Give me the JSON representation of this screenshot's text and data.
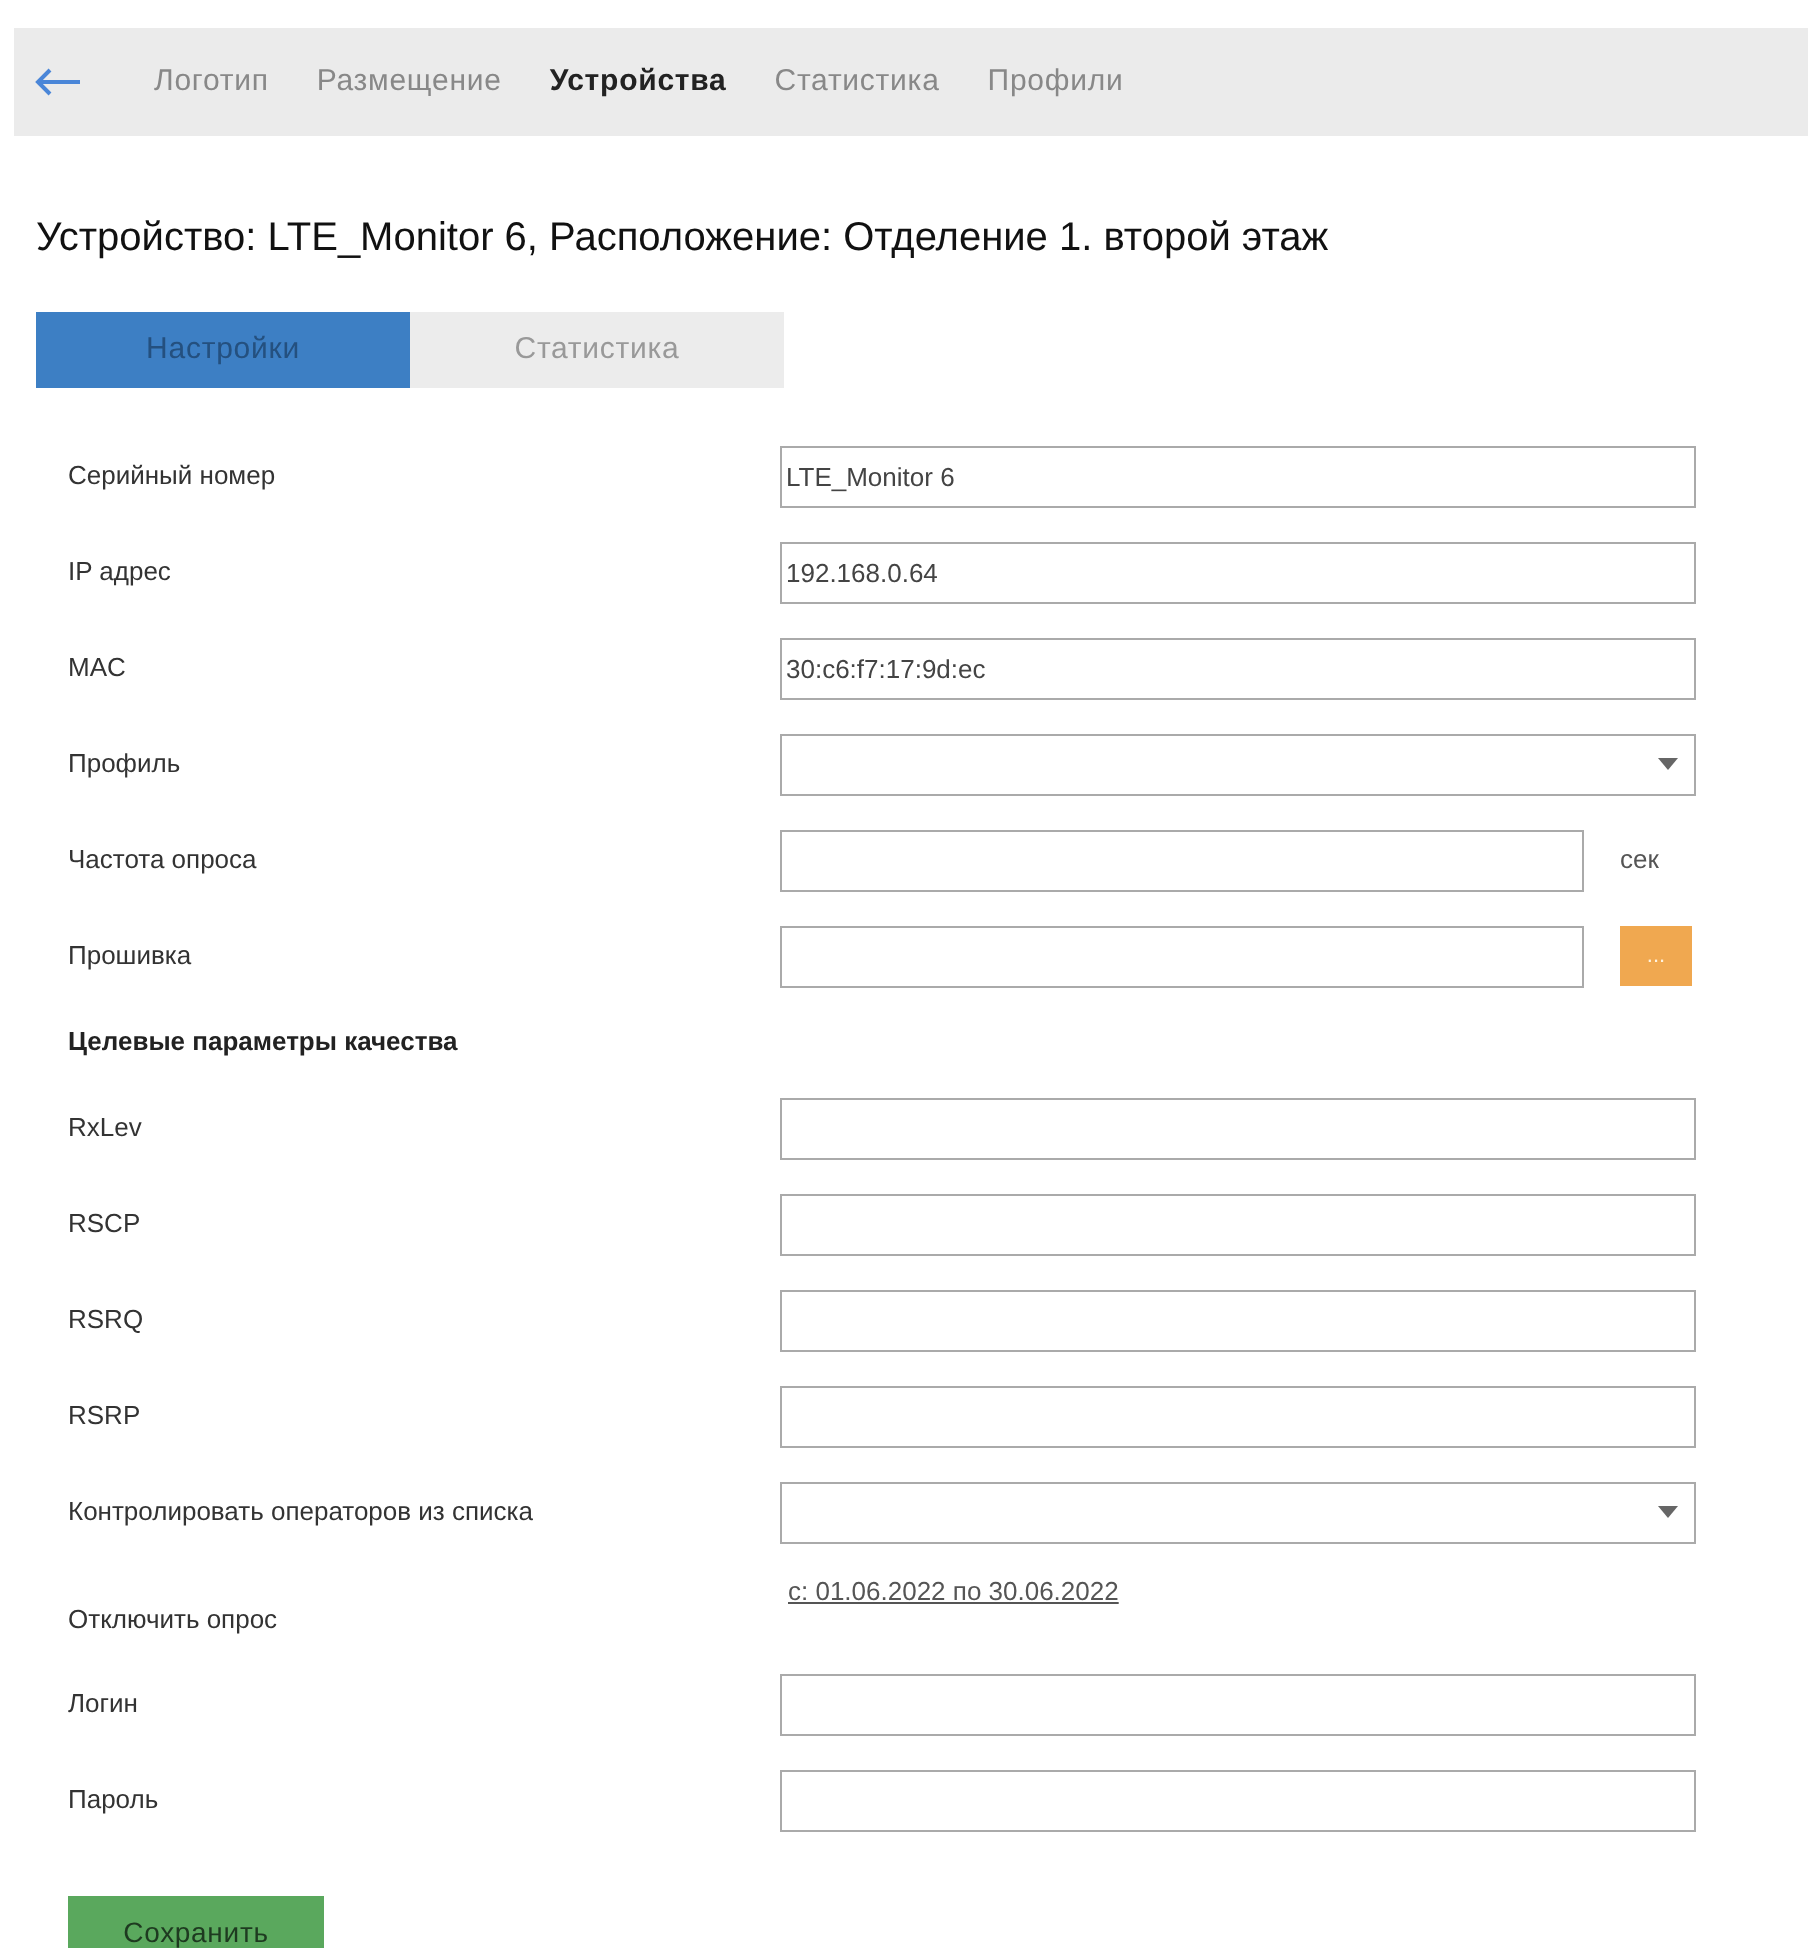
{
  "nav": {
    "items": [
      {
        "label": "Логотип",
        "selected": false
      },
      {
        "label": "Размещение",
        "selected": false
      },
      {
        "label": "Устройства",
        "selected": true
      },
      {
        "label": "Статистика",
        "selected": false
      },
      {
        "label": "Профили",
        "selected": false
      }
    ]
  },
  "title": "Устройство: LTE_Monitor 6, Расположение: Отделение 1. второй этаж",
  "tabs": [
    {
      "label": "Настройки",
      "selected": true
    },
    {
      "label": "Статистика",
      "selected": false
    }
  ],
  "form": {
    "rows": [
      {
        "kind": "text",
        "label": "Серийный номер",
        "value": "LTE_Monitor 6"
      },
      {
        "kind": "text",
        "label": "IP адрес",
        "value": "192.168.0.64"
      },
      {
        "kind": "text",
        "label": "MAC",
        "value": "30:c6:f7:17:9d:ec"
      },
      {
        "kind": "select",
        "label": "Профиль"
      },
      {
        "kind": "suffix",
        "label": "Частота опроса",
        "suffix": "сек"
      },
      {
        "kind": "browse",
        "label": "Прошивка",
        "button": "..."
      },
      {
        "kind": "heading",
        "label": "Целевые параметры качества"
      },
      {
        "kind": "text",
        "label": "RxLev"
      },
      {
        "kind": "text",
        "label": "RSCP"
      },
      {
        "kind": "text",
        "label": "RSRQ"
      },
      {
        "kind": "text",
        "label": "RSRP"
      },
      {
        "kind": "select",
        "label": "Контролировать операторов из списка"
      },
      {
        "kind": "link",
        "label": "Отключить опрос",
        "link": "с: 01.06.2022 по 30.06.2022"
      },
      {
        "kind": "text",
        "label": "Логин"
      },
      {
        "kind": "text",
        "label": "Пароль"
      }
    ]
  },
  "save_button": "Сохранить"
}
